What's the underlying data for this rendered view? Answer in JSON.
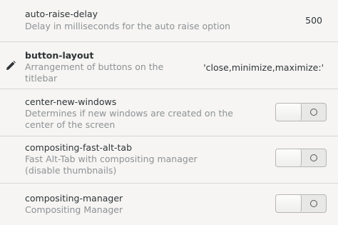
{
  "rows": [
    {
      "key": "auto-raise-delay",
      "description": "Delay in milliseconds for the auto raise option",
      "value": "500"
    },
    {
      "key": "button-layout",
      "description_line1": "Arrangement of buttons on the",
      "description_line2": "titlebar",
      "value": "'close,minimize,maximize:'",
      "modified": true,
      "icon": "pencil-icon"
    },
    {
      "key": "center-new-windows",
      "description_line1": "Determines if new windows are created on the",
      "description_line2": "center of the screen",
      "toggle": false
    },
    {
      "key": "compositing-fast-alt-tab",
      "description_line1": "Fast Alt-Tab with compositing manager",
      "description_line2": "(disable thumbnails)",
      "toggle": false
    },
    {
      "key": "compositing-manager",
      "description": "Compositing Manager",
      "toggle": false
    }
  ]
}
